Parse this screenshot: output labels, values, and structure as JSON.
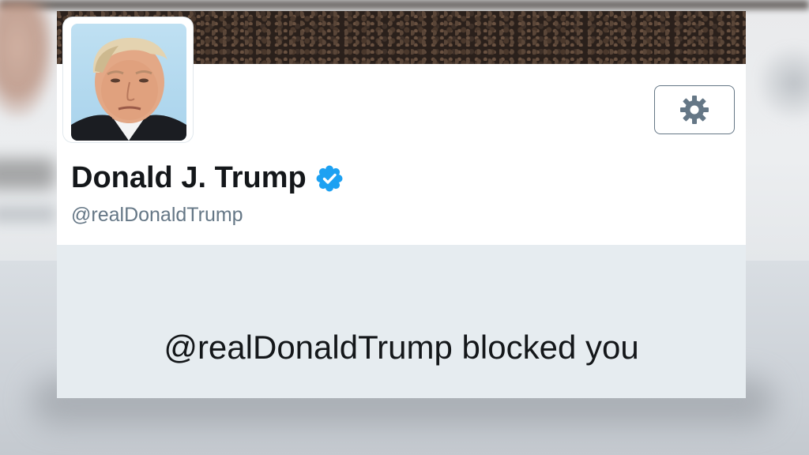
{
  "profile": {
    "name": "Donald J. Trump",
    "handle": "@realDonaldTrump",
    "verified": true,
    "avatar_icon": "profile-photo"
  },
  "settings": {
    "icon": "gear-icon"
  },
  "blocked_message": "@realDonaldTrump blocked you",
  "colors": {
    "verified_blue": "#1da1f2",
    "text_primary": "#14171a",
    "text_secondary": "#657786",
    "panel_bg": "#e6ecf0",
    "card_bg": "#ffffff"
  }
}
